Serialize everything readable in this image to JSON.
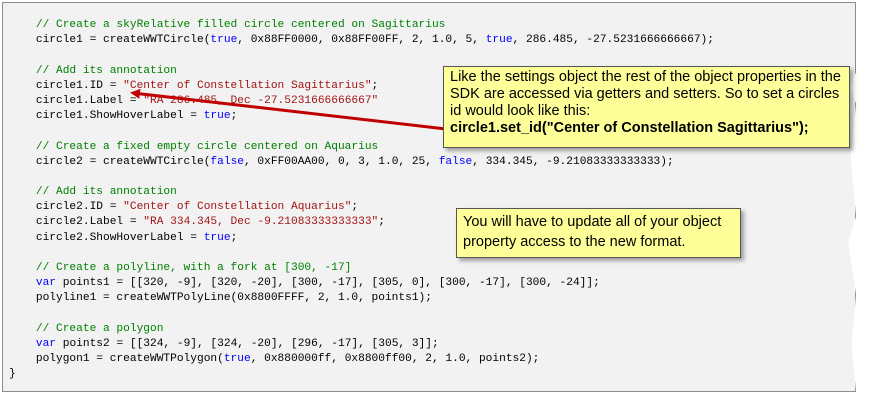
{
  "code_lines": [
    {
      "parts": [
        {
          "t": "    "
        },
        {
          "c": "// Create a skyRelative filled circle centered on Sagittarius"
        }
      ]
    },
    {
      "parts": [
        {
          "t": "    circle1 = createWWTCircle("
        },
        {
          "k": "true"
        },
        {
          "t": ", 0x88FF0000, 0x88FF00FF, 2, 1.0, 5, "
        },
        {
          "k": "true"
        },
        {
          "t": ", 286.485, -27.5231666666667);"
        }
      ]
    },
    {
      "parts": []
    },
    {
      "parts": [
        {
          "t": "    "
        },
        {
          "c": "// Add its annotation"
        }
      ]
    },
    {
      "parts": [
        {
          "t": "    circle1.ID = "
        },
        {
          "s": "\"Center of Constellation Sagittarius\""
        },
        {
          "t": ";"
        }
      ]
    },
    {
      "parts": [
        {
          "t": "    circle1.Label = "
        },
        {
          "s": "\"RA 286.485, Dec -27.5231666666667\""
        }
      ]
    },
    {
      "parts": [
        {
          "t": "    circle1.ShowHoverLabel = "
        },
        {
          "k": "true"
        },
        {
          "t": ";"
        }
      ]
    },
    {
      "parts": []
    },
    {
      "parts": [
        {
          "t": "    "
        },
        {
          "c": "// Create a fixed empty circle centered on Aquarius"
        }
      ]
    },
    {
      "parts": [
        {
          "t": "    circle2 = createWWTCircle("
        },
        {
          "k": "false"
        },
        {
          "t": ", 0xFF00AA00, 0, 3, 1.0, 25, "
        },
        {
          "k": "false"
        },
        {
          "t": ", 334.345, -9.21083333333333);"
        }
      ]
    },
    {
      "parts": []
    },
    {
      "parts": [
        {
          "t": "    "
        },
        {
          "c": "// Add its annotation"
        }
      ]
    },
    {
      "parts": [
        {
          "t": "    circle2.ID = "
        },
        {
          "s": "\"Center of Constellation Aquarius\""
        },
        {
          "t": ";"
        }
      ]
    },
    {
      "parts": [
        {
          "t": "    circle2.Label = "
        },
        {
          "s": "\"RA 334.345, Dec -9.21083333333333\""
        },
        {
          "t": ";"
        }
      ]
    },
    {
      "parts": [
        {
          "t": "    circle2.ShowHoverLabel = "
        },
        {
          "k": "true"
        },
        {
          "t": ";"
        }
      ]
    },
    {
      "parts": []
    },
    {
      "parts": [
        {
          "t": "    "
        },
        {
          "c": "// Create a polyline, with a fork at [300, -17]"
        }
      ]
    },
    {
      "parts": [
        {
          "t": "    "
        },
        {
          "k": "var"
        },
        {
          "t": " points1 = [[320, -9], [320, -20], [300, -17], [305, 0], [300, -17], [300, -24]];"
        }
      ]
    },
    {
      "parts": [
        {
          "t": "    polyline1 = createWWTPolyLine(0x8800FFFF, 2, 1.0, points1);"
        }
      ]
    },
    {
      "parts": []
    },
    {
      "parts": [
        {
          "t": "    "
        },
        {
          "c": "// Create a polygon"
        }
      ]
    },
    {
      "parts": [
        {
          "t": "    "
        },
        {
          "k": "var"
        },
        {
          "t": " points2 = [[324, -9], [324, -20], [296, -17], [305, 3]];"
        }
      ]
    },
    {
      "parts": [
        {
          "t": "    polygon1 = createWWTPolygon("
        },
        {
          "k": "true"
        },
        {
          "t": ", 0x880000ff, 0x8800ff00, 2, 1.0, points2);"
        }
      ]
    },
    {
      "parts": [
        {
          "t": "}"
        }
      ]
    }
  ],
  "callout1": {
    "text": "Like the settings object the rest of the object properties in the SDK are accessed via getters and setters.  So to set a circles id would look like this:",
    "emphasis": "circle1.set_id(\"Center of Constellation Sagittarius\");"
  },
  "callout2": {
    "text": "You will have to update all of your object property access to the new format."
  },
  "colors": {
    "comment": "#008000",
    "keyword": "#0000ff",
    "string": "#a31515",
    "callout_bg": "#ffff9a",
    "arrow": "#c00000"
  }
}
